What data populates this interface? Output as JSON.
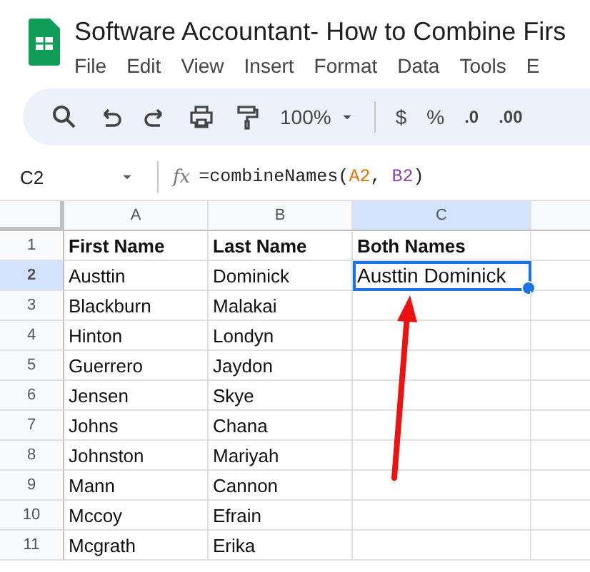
{
  "document": {
    "title": "Software Accountant- How to Combine Firs"
  },
  "menu": [
    "File",
    "Edit",
    "View",
    "Insert",
    "Format",
    "Data",
    "Tools",
    "E"
  ],
  "toolbar": {
    "zoom": "100%",
    "currency": "$",
    "percent": "%",
    "decrease_decimals": ".0",
    "increase_decimals": ".00"
  },
  "formula_bar": {
    "cell_ref": "C2",
    "fx": "fx",
    "formula": [
      {
        "text": "=combineNames("
      },
      {
        "text": "A2",
        "color": "#e37400"
      },
      {
        "text": ", "
      },
      {
        "text": "B2",
        "color": "#8e44ad"
      },
      {
        "text": ")"
      }
    ]
  },
  "columns": [
    {
      "label": "A",
      "selected": false
    },
    {
      "label": "B",
      "selected": false
    },
    {
      "label": "C",
      "selected": true
    }
  ],
  "rows": [
    {
      "number": "1",
      "selected": false,
      "header": true,
      "cells": [
        "First Name",
        "Last Name",
        "Both Names"
      ]
    },
    {
      "number": "2",
      "selected": true,
      "header": false,
      "cells": [
        "Austtin",
        "Dominick",
        "Austtin Dominick"
      ]
    },
    {
      "number": "3",
      "selected": false,
      "header": false,
      "cells": [
        "Blackburn",
        "Malakai",
        ""
      ]
    },
    {
      "number": "4",
      "selected": false,
      "header": false,
      "cells": [
        "Hinton",
        "Londyn",
        ""
      ]
    },
    {
      "number": "5",
      "selected": false,
      "header": false,
      "cells": [
        "Guerrero",
        "Jaydon",
        ""
      ]
    },
    {
      "number": "6",
      "selected": false,
      "header": false,
      "cells": [
        "Jensen",
        "Skye",
        ""
      ]
    },
    {
      "number": "7",
      "selected": false,
      "header": false,
      "cells": [
        "Johns",
        "Chana",
        ""
      ]
    },
    {
      "number": "8",
      "selected": false,
      "header": false,
      "cells": [
        "Johnston",
        "Mariyah",
        ""
      ]
    },
    {
      "number": "9",
      "selected": false,
      "header": false,
      "cells": [
        "Mann",
        "Cannon",
        ""
      ]
    },
    {
      "number": "10",
      "selected": false,
      "header": false,
      "cells": [
        "Mccoy",
        "Efrain",
        ""
      ]
    },
    {
      "number": "11",
      "selected": false,
      "header": false,
      "cells": [
        "Mcgrath",
        "Erika",
        ""
      ]
    }
  ]
}
